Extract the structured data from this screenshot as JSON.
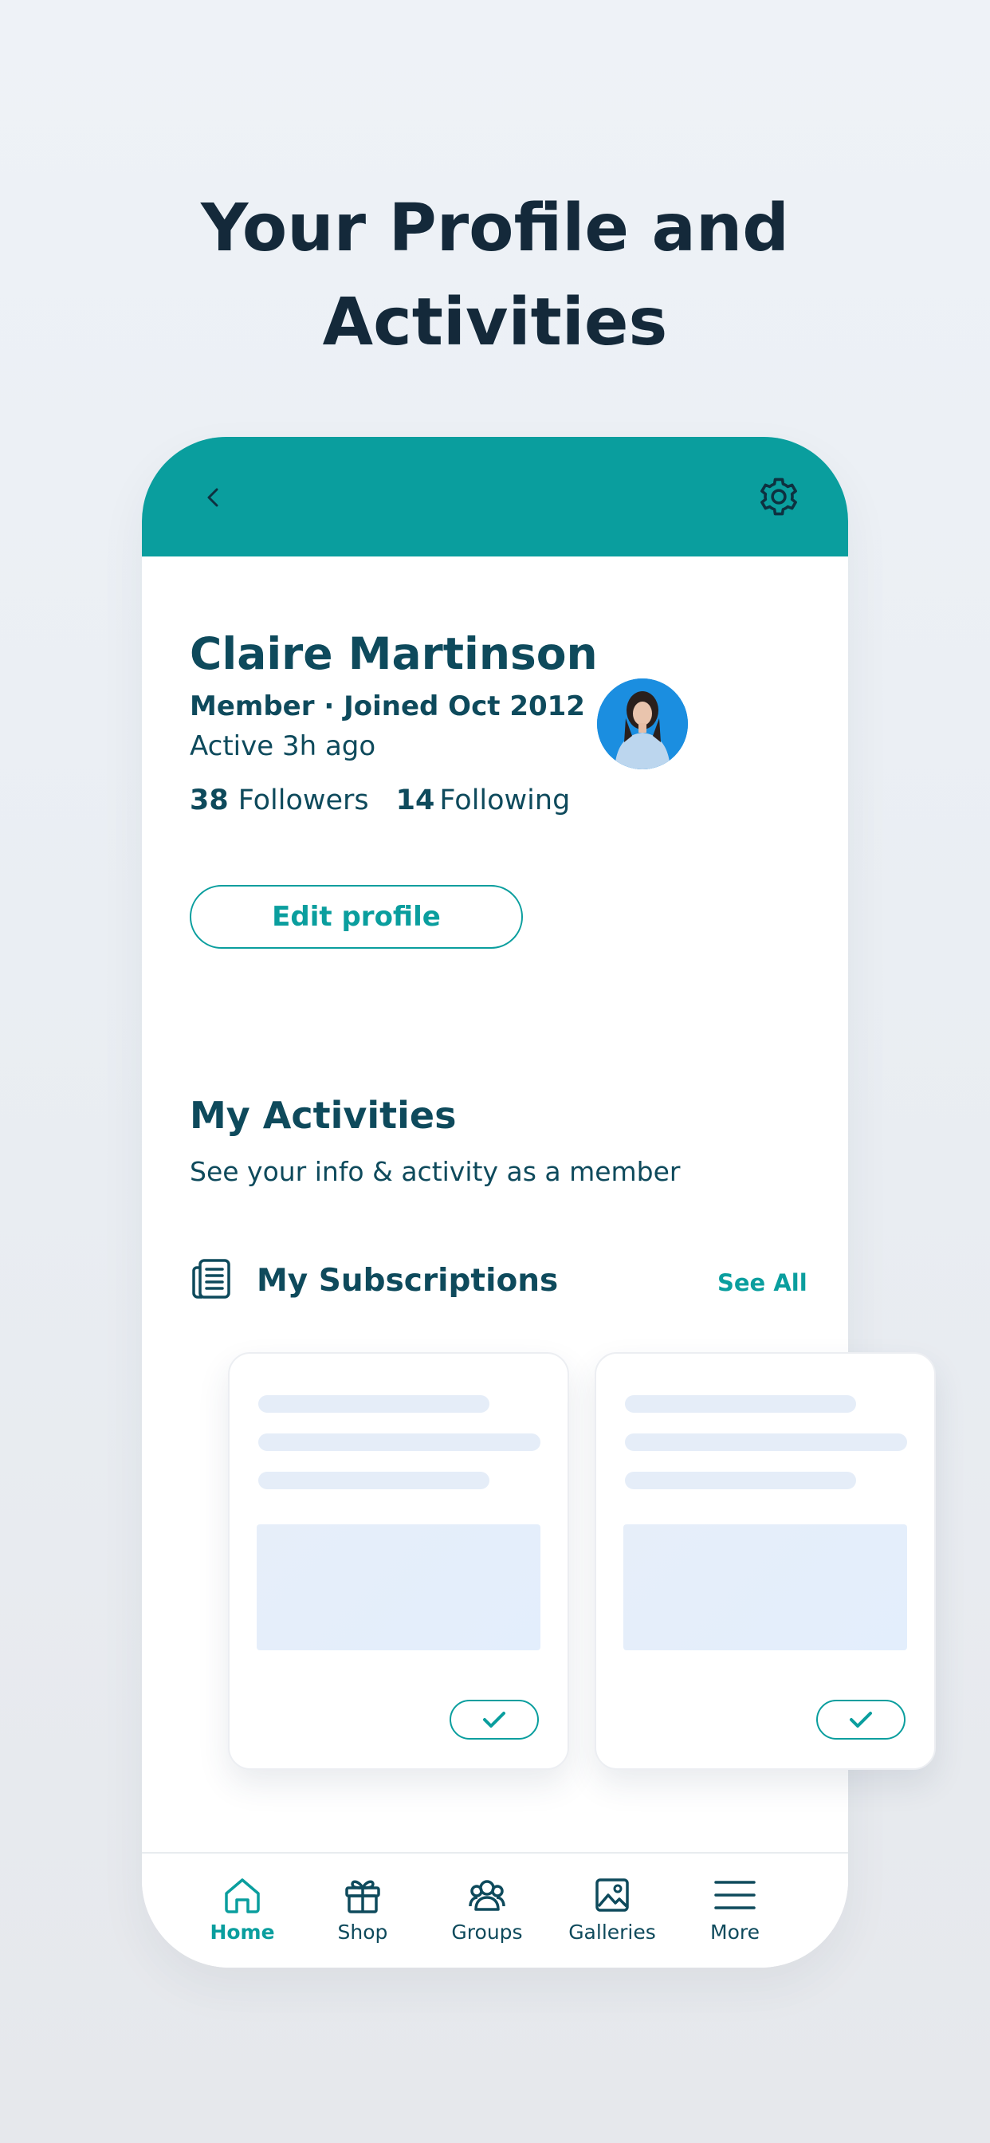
{
  "headline": {
    "line1": "Your Profile and",
    "line2": "Activities"
  },
  "colors": {
    "accent": "#0a9e9e",
    "text_dark": "#0e4a5c",
    "headline": "#14293a",
    "skeleton": "#e5edf8"
  },
  "topbar": {
    "back_icon": "chevron-left-icon",
    "settings_icon": "gear-icon"
  },
  "profile": {
    "name": "Claire Martinson",
    "member_line": "Member · Joined Oct 2012",
    "active_line": "Active 3h ago",
    "followers_count": "38",
    "followers_label": "Followers",
    "following_count": "14",
    "following_label": "Following",
    "edit_button": "Edit profile"
  },
  "activities": {
    "title": "My Activities",
    "subtitle": "See your info & activity as a member",
    "subscriptions_title": "My Subscriptions",
    "see_all": "See All",
    "subscriptions_icon": "newspaper-icon"
  },
  "tabs": [
    {
      "label": "Home",
      "icon": "home-icon",
      "active": true
    },
    {
      "label": "Shop",
      "icon": "gift-icon",
      "active": false
    },
    {
      "label": "Groups",
      "icon": "groups-icon",
      "active": false
    },
    {
      "label": "Galleries",
      "icon": "image-icon",
      "active": false
    },
    {
      "label": "More",
      "icon": "menu-icon",
      "active": false
    }
  ]
}
